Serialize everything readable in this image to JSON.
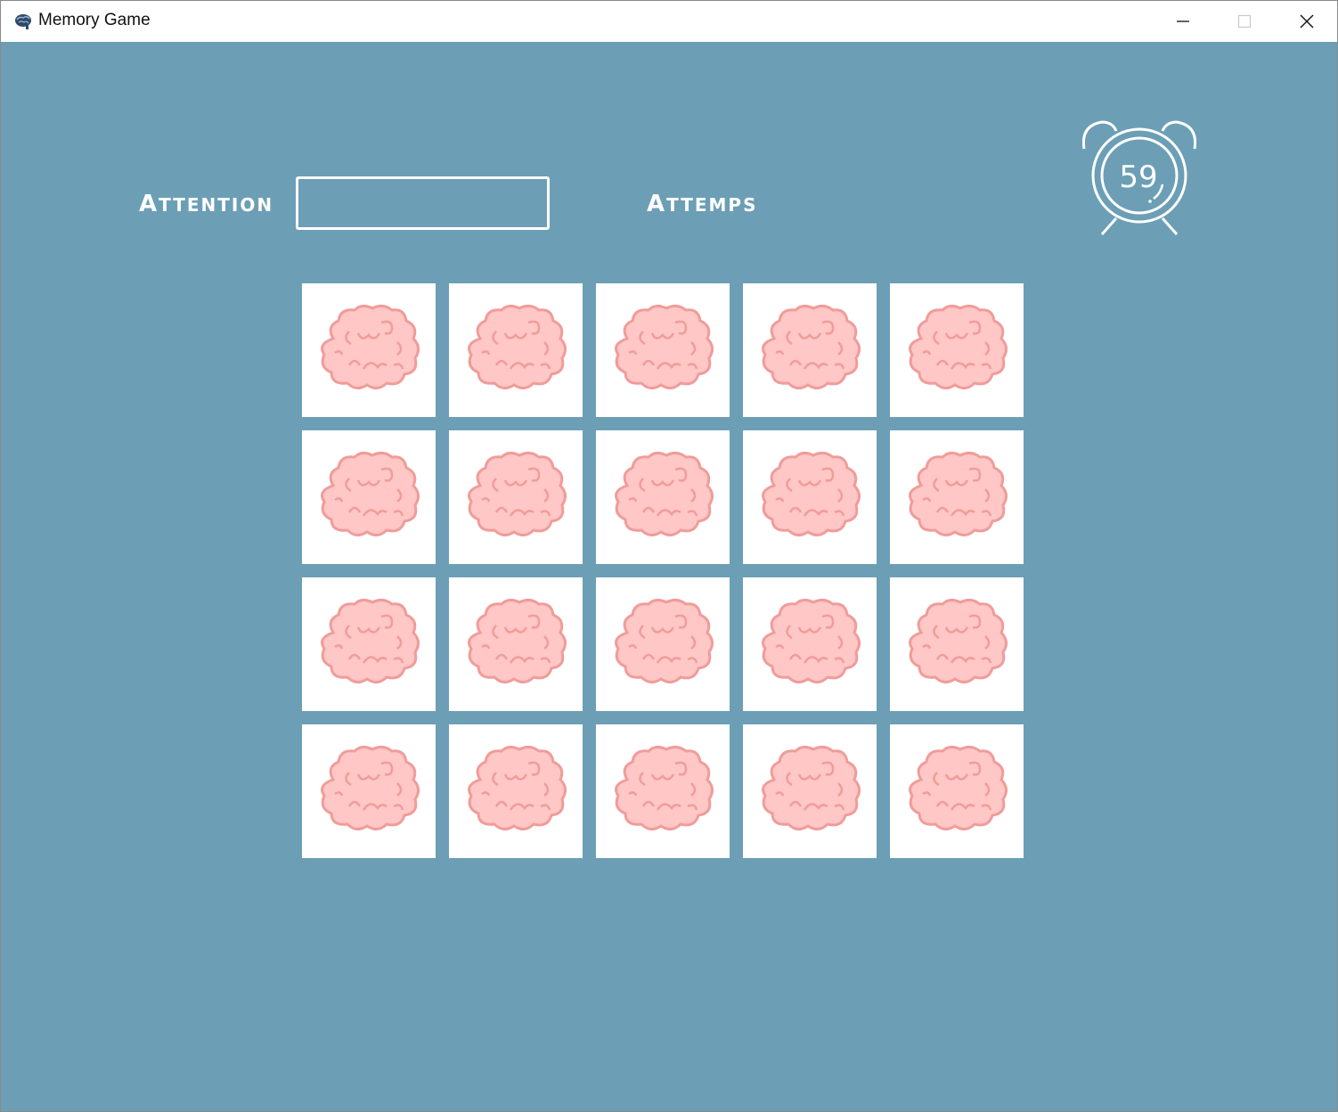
{
  "window": {
    "title": "Memory Game",
    "controls": {
      "minimize": "minimize-icon",
      "maximize": "maximize-icon",
      "close": "close-icon"
    }
  },
  "hud": {
    "attention_label": "Attention",
    "attention_value": "",
    "attempts_label": "Attemps",
    "timer_value": "59"
  },
  "colors": {
    "background": "#6c9fb6",
    "card": "#ffffff",
    "brain_fill": "#ffc7c5",
    "brain_outline": "#f09c9a"
  },
  "board": {
    "rows": 4,
    "columns": 5,
    "cards": [
      {
        "face": "brain-icon",
        "state": "hidden"
      },
      {
        "face": "brain-icon",
        "state": "hidden"
      },
      {
        "face": "brain-icon",
        "state": "hidden"
      },
      {
        "face": "brain-icon",
        "state": "hidden"
      },
      {
        "face": "brain-icon",
        "state": "hidden"
      },
      {
        "face": "brain-icon",
        "state": "hidden"
      },
      {
        "face": "brain-icon",
        "state": "hidden"
      },
      {
        "face": "brain-icon",
        "state": "hidden"
      },
      {
        "face": "brain-icon",
        "state": "hidden"
      },
      {
        "face": "brain-icon",
        "state": "hidden"
      },
      {
        "face": "brain-icon",
        "state": "hidden"
      },
      {
        "face": "brain-icon",
        "state": "hidden"
      },
      {
        "face": "brain-icon",
        "state": "hidden"
      },
      {
        "face": "brain-icon",
        "state": "hidden"
      },
      {
        "face": "brain-icon",
        "state": "hidden"
      },
      {
        "face": "brain-icon",
        "state": "hidden"
      },
      {
        "face": "brain-icon",
        "state": "hidden"
      },
      {
        "face": "brain-icon",
        "state": "hidden"
      },
      {
        "face": "brain-icon",
        "state": "hidden"
      },
      {
        "face": "brain-icon",
        "state": "hidden"
      }
    ]
  }
}
